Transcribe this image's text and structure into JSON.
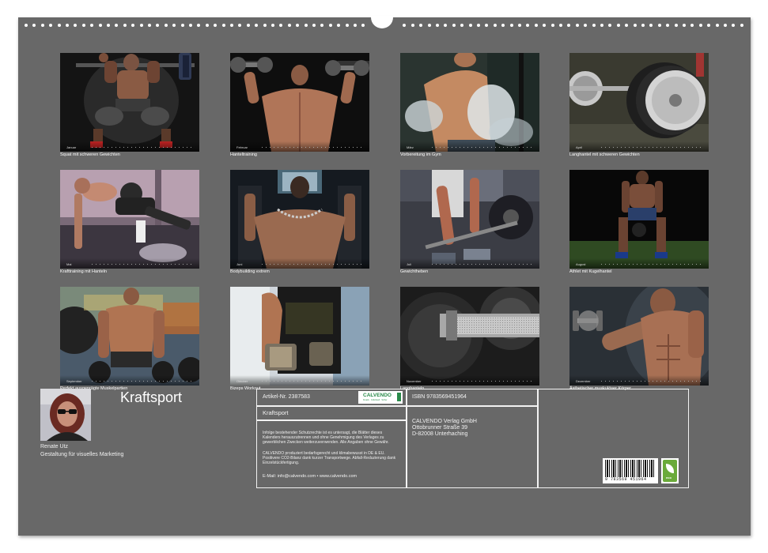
{
  "calendar": {
    "title": "Kraftsport",
    "months": [
      {
        "month": "Januar",
        "caption": "Squat mit schweren Gewichten"
      },
      {
        "month": "Februar",
        "caption": "Hanteltraining"
      },
      {
        "month": "März",
        "caption": "Vorbereitung im Gym"
      },
      {
        "month": "April",
        "caption": "Langhantel mit schweren Gewichten"
      },
      {
        "month": "Mai",
        "caption": "Krafttraining mit Hanteln"
      },
      {
        "month": "Juni",
        "caption": "Bodybuilding extrem"
      },
      {
        "month": "Juli",
        "caption": "Gewichtheben"
      },
      {
        "month": "August",
        "caption": "Athlet mit Kugelhantel"
      },
      {
        "month": "September",
        "caption": "Perfekt ausgeprägte Muskelpartien"
      },
      {
        "month": "Oktober",
        "caption": "Bizeps Workout"
      },
      {
        "month": "November",
        "caption": "Langhanteln"
      },
      {
        "month": "Dezember",
        "caption": "Ästhetischer muskulöser Körper"
      }
    ]
  },
  "author": {
    "name": "Renate Utz",
    "description": "Gestaltung für visuelles Marketing"
  },
  "info": {
    "article": "Artikel-Nr. 2387583",
    "isbn": "ISBN 9783569451964",
    "title": "Kraftsport",
    "publisher": [
      "CALVENDO Verlag GmbH",
      "Ottobrunner Straße 39",
      "D-82008 Unterhaching"
    ],
    "logo": "CALVENDO",
    "logo_sub": "Kreativ · Individuell · Sicher",
    "legal1": "Infolge bestehender Schutzrechte ist es untersagt, die Blätter dieses Kalenders herauszutrennen und ohne Genehmigung des Verlages zu gewerblichen Zwecken weiterzuverwenden. Alle Angaben ohne Gewähr.",
    "legal2": "CALVENDO produziert bedarfsgerecht und klimabewusst in DE & EU. Positivere CO2-Bilanz dank kurzer Transportwege. Abfall-Reduzierung dank Einzelstückfertigung.",
    "contact": "E-Mail: info@calvendo.com • www.calvendo.com",
    "barcode_number": "9 783569 451964",
    "eco_label": "eco"
  },
  "colors": {
    "page": "#686868",
    "text": "#ffffff",
    "logo_green": "#2a8a4a"
  }
}
